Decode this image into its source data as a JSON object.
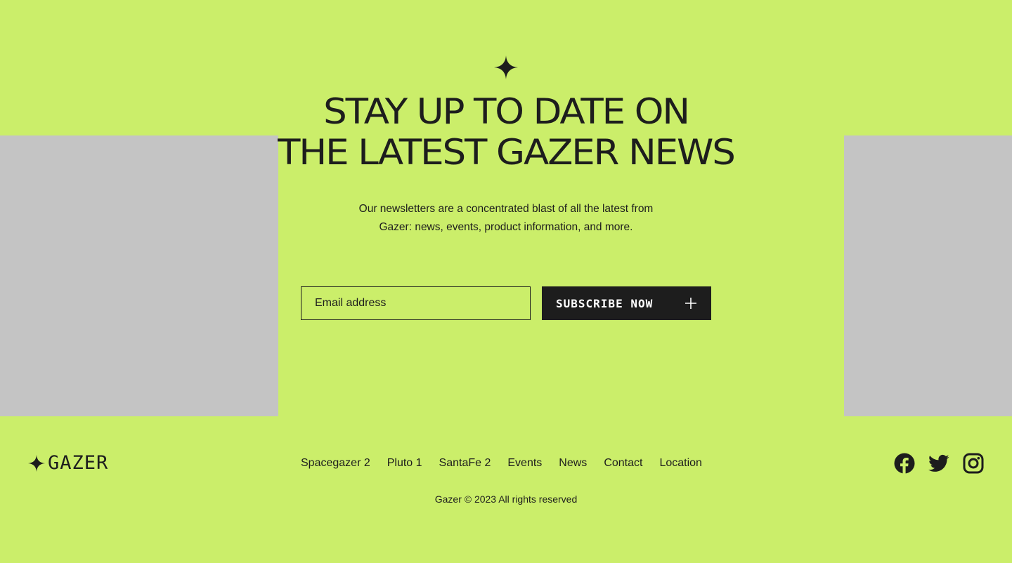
{
  "colors": {
    "background": "#cbee6a",
    "placeholder_panel": "#c4c4c4",
    "ink": "#1d1d1d",
    "button_text": "#ffffff"
  },
  "newsletter": {
    "icon": "sparkle-star-icon",
    "headline_line1": "STAY UP TO DATE ON",
    "headline_line2": "THE LATEST GAZER NEWS",
    "intro_line1": "Our newsletters are a concentrated blast of all the latest from",
    "intro_line2": "Gazer: news, events, product information, and more.",
    "email_placeholder": "Email address",
    "email_value": "",
    "subscribe_label": "SUBSCRIBE NOW",
    "subscribe_icon": "plus-icon"
  },
  "footer": {
    "logo_icon": "sparkle-star-icon",
    "logo_text": "GAZER",
    "nav": [
      {
        "label": "Spacegazer 2"
      },
      {
        "label": "Pluto 1"
      },
      {
        "label": "SantaFe 2"
      },
      {
        "label": "Events"
      },
      {
        "label": "News"
      },
      {
        "label": "Contact"
      },
      {
        "label": "Location"
      }
    ],
    "social": [
      {
        "name": "facebook-icon"
      },
      {
        "name": "twitter-icon"
      },
      {
        "name": "instagram-icon"
      }
    ],
    "copyright": "Gazer © 2023 All rights reserved"
  }
}
